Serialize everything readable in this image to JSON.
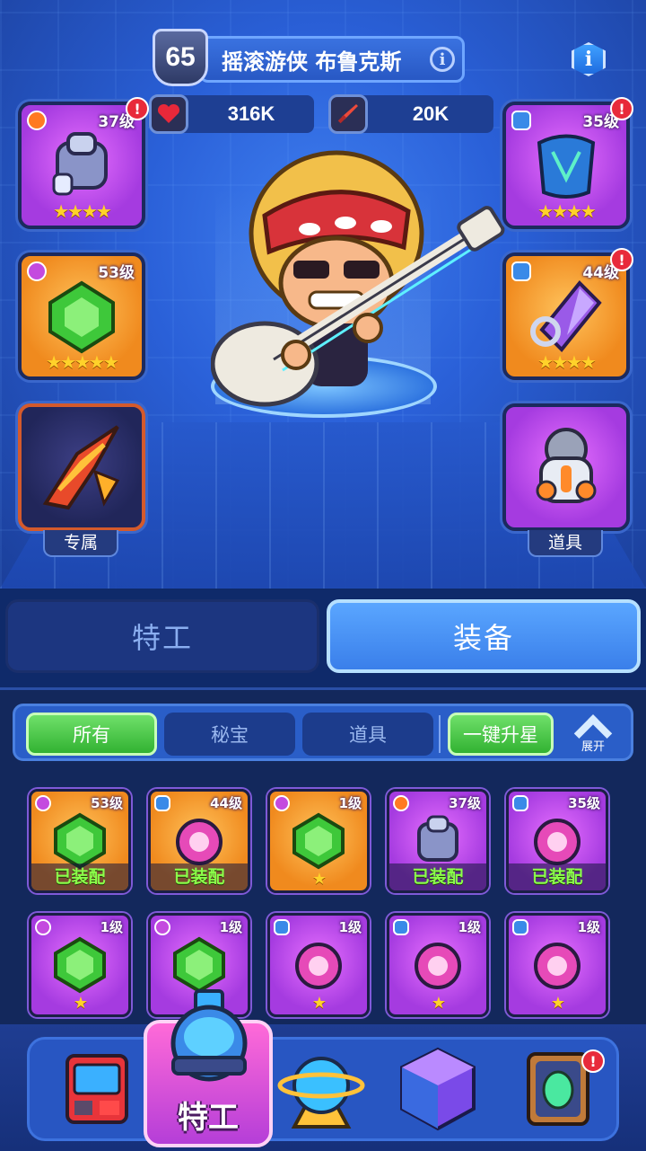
{
  "hero": {
    "level": "65",
    "name": "摇滚游侠 布鲁克斯",
    "info_icon": "info-icon",
    "hp": "316K",
    "attack": "20K"
  },
  "slots": {
    "left": [
      {
        "level": "37级",
        "stars": "★★★★",
        "type": "crown",
        "alert": "!"
      },
      {
        "level": "53级",
        "stars": "★★★★★",
        "type": "circle",
        "alert": ""
      },
      {
        "label": "专属"
      }
    ],
    "right": [
      {
        "level": "35级",
        "stars": "★★★★",
        "type": "shield",
        "alert": "!"
      },
      {
        "level": "44级",
        "stars": "★★★★",
        "type": "shield",
        "alert": "!"
      },
      {
        "label": "道具"
      }
    ]
  },
  "tabs": {
    "agent": "特工",
    "equipment": "装备"
  },
  "filters": {
    "all": "所有",
    "secret": "秘宝",
    "item": "道具",
    "upgrade": "一键升星",
    "expand": "展开"
  },
  "inventory": [
    {
      "level": "53级",
      "status": "已装配",
      "color": "orange",
      "type": "circle",
      "stars": ""
    },
    {
      "level": "44级",
      "status": "已装配",
      "color": "orange",
      "type": "shield",
      "stars": ""
    },
    {
      "level": "1级",
      "status": "",
      "color": "orange",
      "type": "circle",
      "stars": "★"
    },
    {
      "level": "37级",
      "status": "已装配",
      "color": "purple",
      "type": "crown",
      "stars": ""
    },
    {
      "level": "35级",
      "status": "已装配",
      "color": "purple",
      "type": "shield",
      "stars": ""
    },
    {
      "level": "1级",
      "status": "",
      "color": "purple",
      "type": "circle",
      "stars": "★"
    },
    {
      "level": "1级",
      "status": "",
      "color": "purple",
      "type": "circle",
      "stars": "★"
    },
    {
      "level": "1级",
      "status": "",
      "color": "purple",
      "type": "shield",
      "stars": "★"
    },
    {
      "level": "1级",
      "status": "",
      "color": "purple",
      "type": "shield",
      "stars": "★"
    },
    {
      "level": "1级",
      "status": "",
      "color": "purple",
      "type": "shield",
      "stars": "★"
    }
  ],
  "nav": {
    "active_label": "特工",
    "items": [
      "arcade-icon",
      "agent-icon",
      "planet-icon",
      "cube-icon",
      "relic-icon"
    ]
  },
  "colors": {
    "accent": "#3a7fea",
    "equipped_text": "#8bff4a",
    "alert": "#e82a3a"
  }
}
